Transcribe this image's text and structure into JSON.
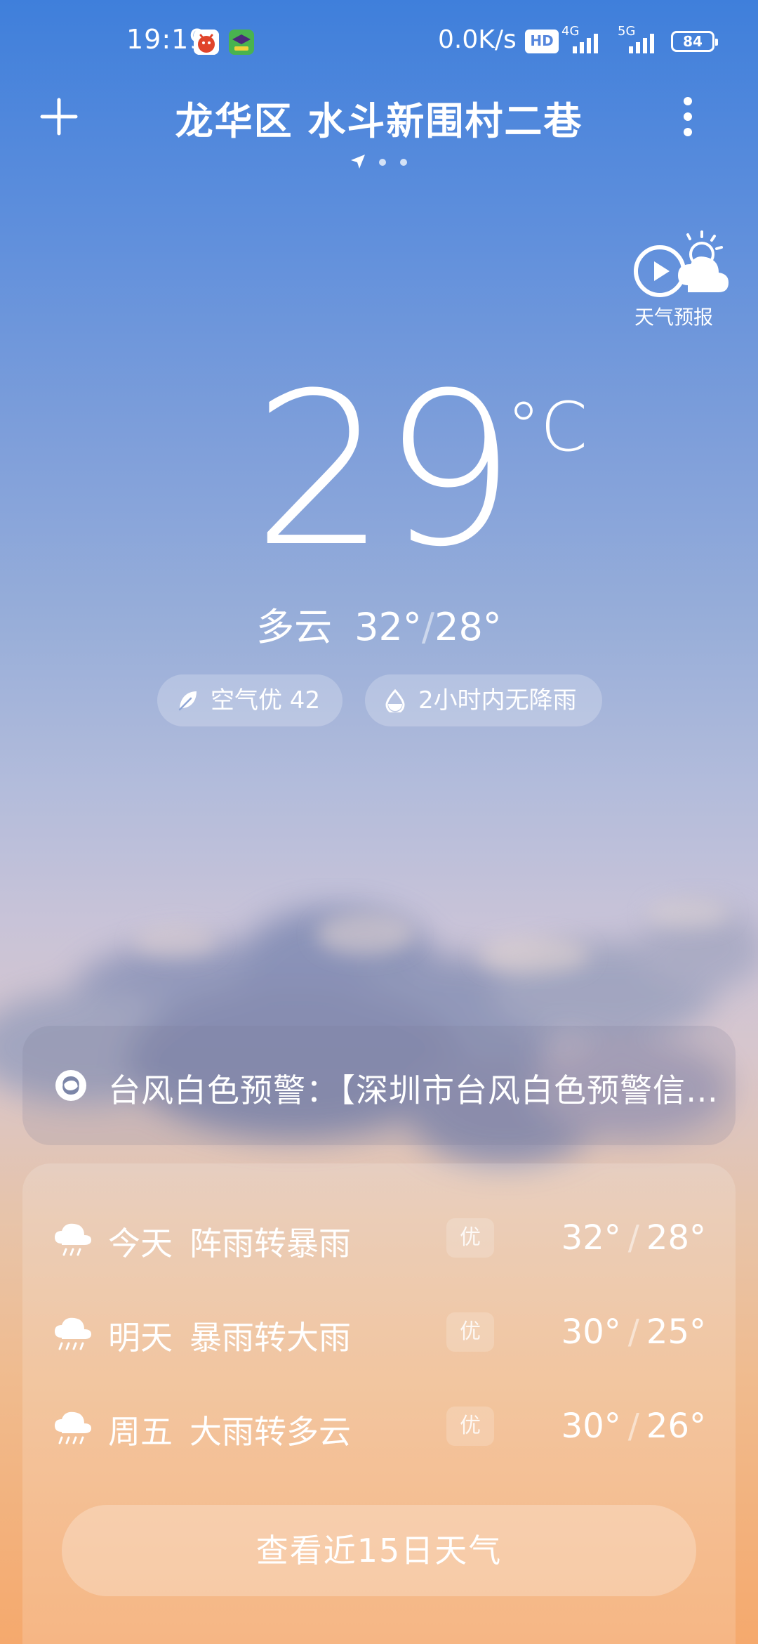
{
  "status_bar": {
    "time": "19:19",
    "net_speed": "0.0K/s",
    "hd_label": "HD",
    "net_type_1": "4G",
    "net_type_2": "5G",
    "battery": "84"
  },
  "header": {
    "location": "龙华区 水斗新围村二巷",
    "page_count": 3,
    "current_page": 1
  },
  "forecast_video": {
    "label": "天气预报"
  },
  "current": {
    "temperature": "29",
    "unit": "°C",
    "condition": "多云",
    "high": "32°",
    "low": "28°",
    "separator": "/"
  },
  "chips": {
    "air_quality": "空气优 42",
    "rain": "2小时内无降雨"
  },
  "alert": {
    "text": "台风白色预警：【深圳市台风白色预警信号】"
  },
  "daily": [
    {
      "day": "今天",
      "desc": "阵雨转暴雨",
      "aqi": "优",
      "high": "32°",
      "low": "28°",
      "icon": "rain-cloud-icon"
    },
    {
      "day": "明天",
      "desc": "暴雨转大雨",
      "aqi": "优",
      "high": "30°",
      "low": "25°",
      "icon": "heavy-rain-cloud-icon"
    },
    {
      "day": "周五",
      "desc": "大雨转多云",
      "aqi": "优",
      "high": "30°",
      "low": "26°",
      "icon": "heavy-rain-cloud-icon"
    }
  ],
  "more_button": "查看近15日天气"
}
